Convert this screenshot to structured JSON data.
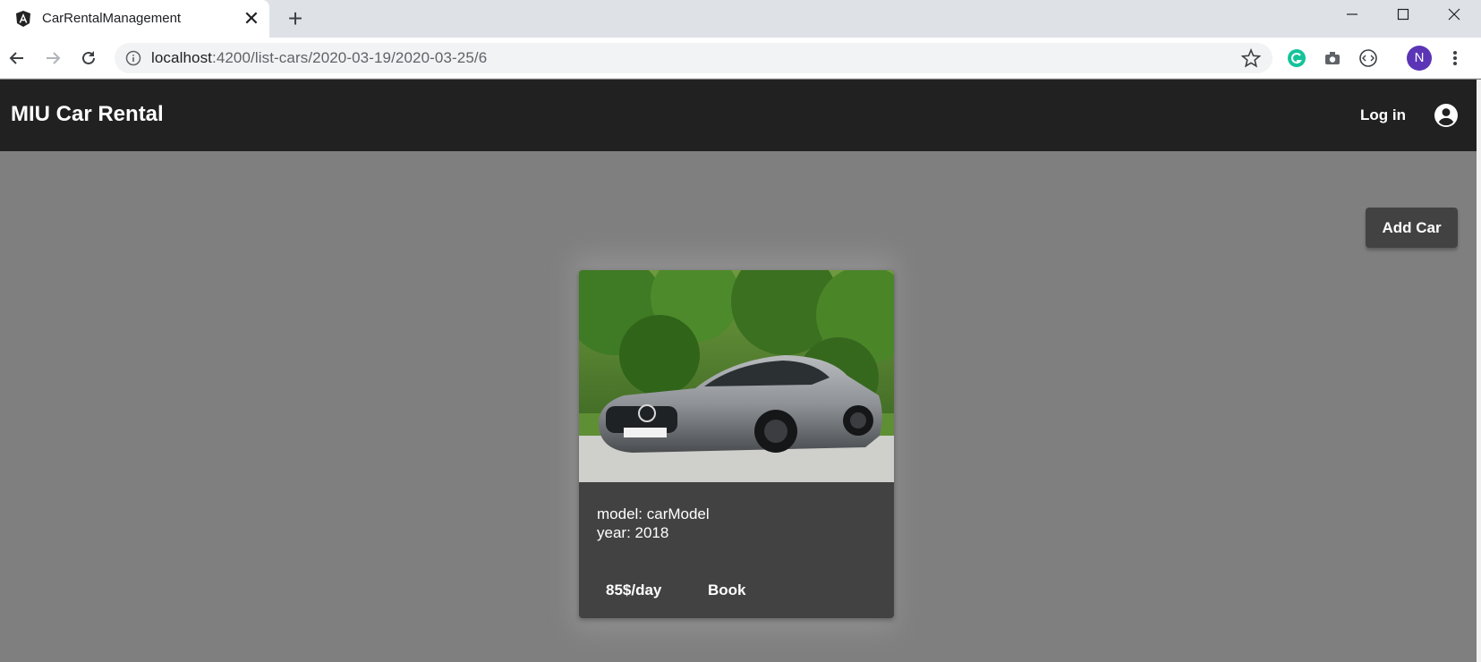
{
  "browser": {
    "tab_title": "CarRentalManagement",
    "tab_close": "✕",
    "new_tab": "+",
    "url_host": "localhost",
    "url_rest": ":4200/list-cars/2020-03-19/2020-03-25/6",
    "profile_initial": "N",
    "icons": {
      "favicon": "angular-icon",
      "back": "back-arrow-icon",
      "forward": "forward-arrow-icon",
      "reload": "reload-icon",
      "info": "info-icon",
      "bookmark": "star-icon",
      "extensions": [
        "grammarly-icon",
        "camera-icon",
        "code-icon"
      ],
      "menu": "more-vertical-icon"
    }
  },
  "app": {
    "brand": "MIU Car Rental",
    "login_label": "Log in",
    "account_icon": "account-circle-icon",
    "add_car_label": "Add Car",
    "colors": {
      "toolbar": "#212121",
      "background": "#7f7f7f",
      "card": "#424242",
      "button": "#424242"
    },
    "cars": [
      {
        "model_text": "model: carModel",
        "year_text": "year: 2018",
        "price_label": "85$/day",
        "book_label": "Book",
        "image": "car-photo"
      }
    ]
  }
}
